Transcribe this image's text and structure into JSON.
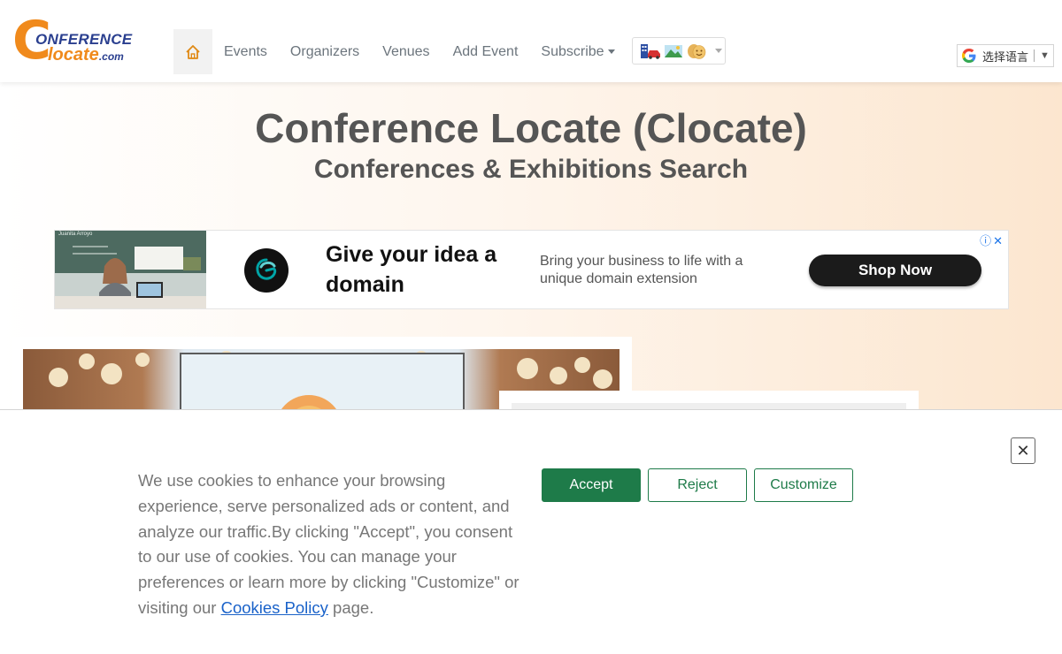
{
  "logo": {
    "letter": "C",
    "top": "ONFERENCE",
    "bottom": "locate",
    "domain": ".com"
  },
  "nav": {
    "home_icon": "home-icon",
    "items": [
      "Events",
      "Organizers",
      "Venues",
      "Add Event",
      "Subscribe"
    ]
  },
  "category_dropdown": {
    "icons": [
      "hotel-car-icon",
      "landscape-icon",
      "theater-masks-icon"
    ]
  },
  "translate": {
    "label": "选择语言",
    "arrow": "▼"
  },
  "hero": {
    "title": "Conference Locate (Clocate)",
    "subtitle": "Conferences & Exhibitions Search"
  },
  "ad": {
    "headline": "Give your idea a domain",
    "body": "Bring your business to life with a unique domain extension",
    "button": "Shop Now",
    "corner": "ⓘ✕",
    "photo_caption": "Juanita Arroyo"
  },
  "cookie": {
    "text": "We use cookies to enhance your browsing experience, serve personalized ads or content, and analyze our traffic.By clicking \"Accept\", you consent to our use of cookies. You can manage your preferences or learn more by clicking \"Customize\" or visiting our ",
    "link": "Cookies Policy",
    "text_end": " page.",
    "accept": "Accept",
    "reject": "Reject",
    "customize": "Customize",
    "close": "✕"
  },
  "colors": {
    "brand_orange": "#f08a1c",
    "brand_blue": "#2a3f8f",
    "accept_green": "#1e7b49"
  }
}
